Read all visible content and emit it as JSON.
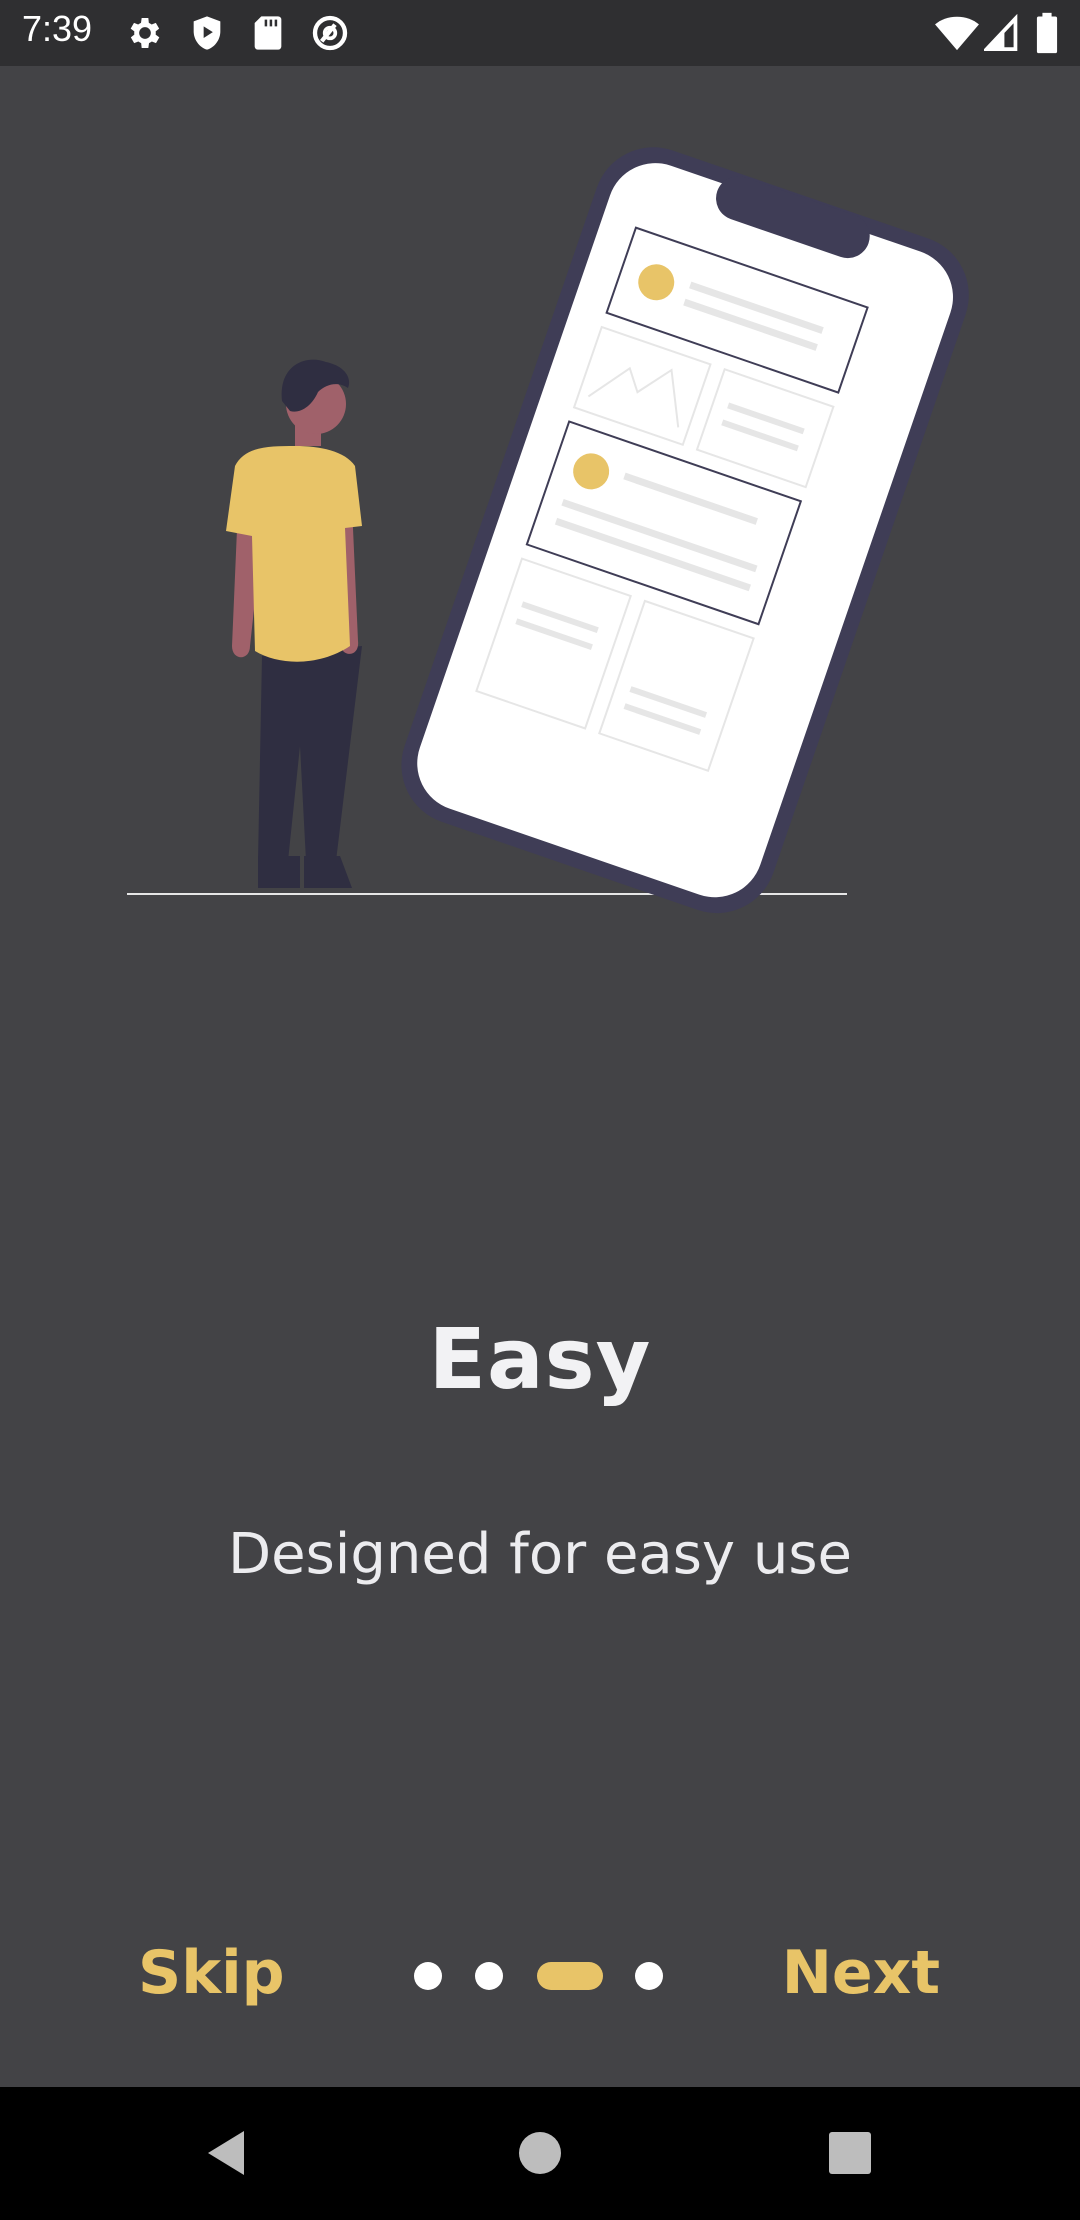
{
  "status_bar": {
    "time": "7:39",
    "left_icons": [
      "settings-icon",
      "shield-play-icon",
      "sd-card-icon",
      "at-sign-icon"
    ],
    "right_icons": [
      "wifi-icon",
      "signal-icon",
      "battery-icon"
    ]
  },
  "onboarding": {
    "title": "Easy",
    "subtitle": "Designed for easy use",
    "skip_label": "Skip",
    "next_label": "Next",
    "page_count": 4,
    "current_page": 3
  },
  "colors": {
    "background": "#434346",
    "accent": "#e8c468",
    "status_bar": "#2f2f31",
    "nav_bar": "#000000"
  },
  "nav_bar": {
    "buttons": [
      "back-icon",
      "home-icon",
      "recents-icon"
    ]
  }
}
